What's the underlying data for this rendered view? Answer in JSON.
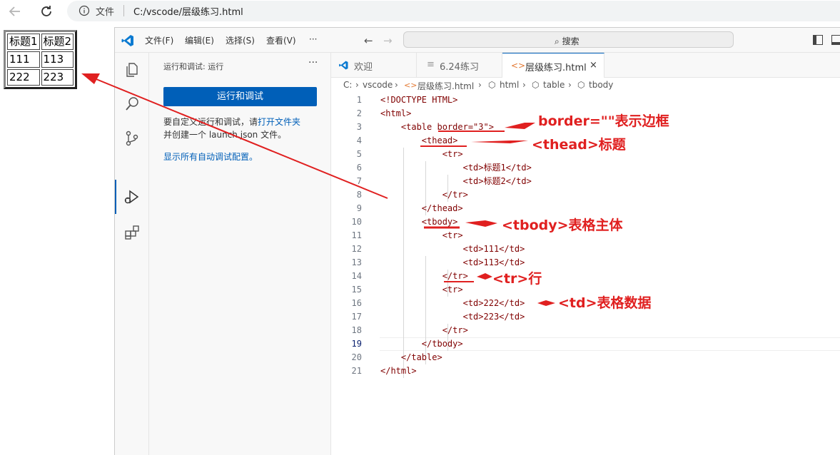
{
  "browser": {
    "file_label": "文件",
    "url": "C:/vscode/层级练习.html"
  },
  "rendered_table": {
    "rows": [
      [
        "标题1",
        "标题2"
      ],
      [
        "111",
        "113"
      ],
      [
        "222",
        "223"
      ]
    ]
  },
  "vscode": {
    "menu": [
      "文件(F)",
      "编辑(E)",
      "选择(S)",
      "查看(V)",
      "···"
    ],
    "search_label": "搜索",
    "sidebar": {
      "title": "运行和调试: 运行",
      "more": "···",
      "run_button": "运行和调试",
      "desc_line1_a": "要自定义运行和调试，请",
      "desc_line1_link": "打开文件夹",
      "desc_line2": "并创建一个 launch.json 文件。",
      "show_configs_link": "显示所有自动调试配置。"
    },
    "tabs": [
      {
        "label": "欢迎"
      },
      {
        "label": "6.24练习"
      },
      {
        "label": "层级练习.html",
        "close": "×"
      }
    ],
    "breadcrumb": [
      "C:",
      "vscode",
      "层级练习.html",
      "html",
      "table",
      "tbody"
    ],
    "breadcrumb_sep": "›",
    "code_lines": [
      {
        "n": "1",
        "text": "<!DOCTYPE HTML>"
      },
      {
        "n": "2",
        "text": "<html>"
      },
      {
        "n": "3",
        "text": "    <table border=\"3\">"
      },
      {
        "n": "4",
        "text": "        <thead>"
      },
      {
        "n": "5",
        "text": "            <tr>"
      },
      {
        "n": "6",
        "text": "                <td>标题1</td>"
      },
      {
        "n": "7",
        "text": "                <td>标题2</td>"
      },
      {
        "n": "8",
        "text": "            </tr>"
      },
      {
        "n": "9",
        "text": "        </thead>"
      },
      {
        "n": "10",
        "text": "        <tbody>"
      },
      {
        "n": "11",
        "text": "            <tr>"
      },
      {
        "n": "12",
        "text": "                <td>111</td>"
      },
      {
        "n": "13",
        "text": "                <td>113</td>"
      },
      {
        "n": "14",
        "text": "            </tr>"
      },
      {
        "n": "15",
        "text": "            <tr>"
      },
      {
        "n": "16",
        "text": "                <td>222</td>"
      },
      {
        "n": "17",
        "text": "                <td>223</td>"
      },
      {
        "n": "18",
        "text": "            </tr>"
      },
      {
        "n": "19",
        "text": "        </tbody>"
      },
      {
        "n": "20",
        "text": "    </table>"
      },
      {
        "n": "21",
        "text": "</html>"
      }
    ],
    "active_line": "19"
  },
  "annotations": {
    "border": "border=\"\"表示边框",
    "thead": "<thead>标题",
    "tbody": "<tbody>表格主体",
    "tr": "<tr>行",
    "td": "<td>表格数据"
  },
  "colors": {
    "accent": "#005fb8",
    "annotation": "#e02020"
  }
}
